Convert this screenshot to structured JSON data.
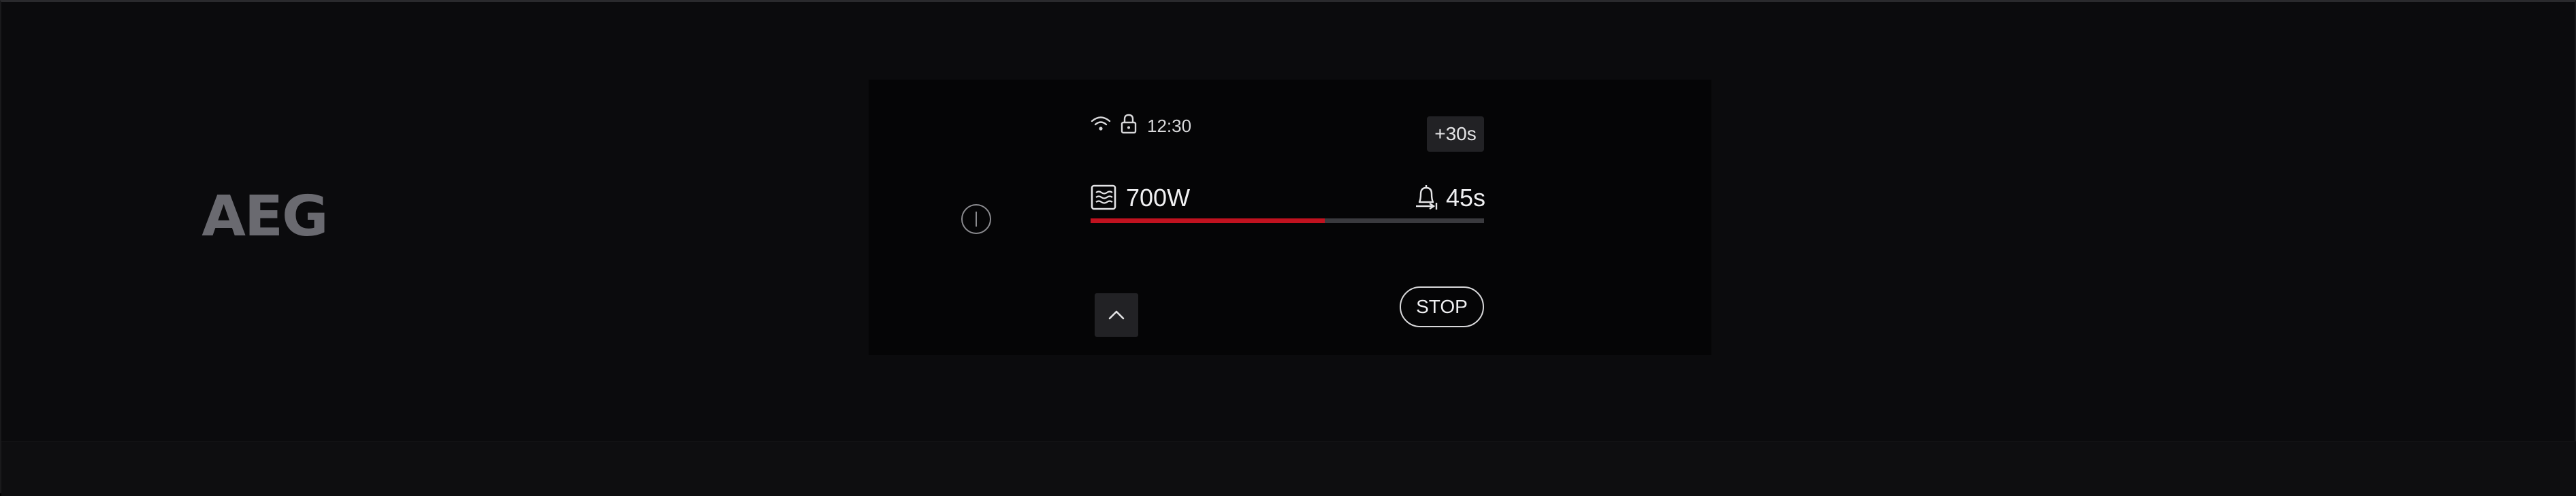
{
  "brand": {
    "logo_text": "AEG"
  },
  "status_bar": {
    "icons": [
      "wifi-icon",
      "lock-icon"
    ],
    "time": "12:30"
  },
  "controls": {
    "add_time_label": "+30s",
    "stop_label": "STOP",
    "power_icon": "power-icon",
    "up_icon": "chevron-up-icon"
  },
  "cooking": {
    "mode_icon": "microwave-icon",
    "power": "700W",
    "timer_icon": "bell-timer-icon",
    "remaining": "45s",
    "progress_fraction": 0.595
  },
  "colors": {
    "progress_fill": "#c1121f",
    "progress_track": "#3a3a3e",
    "logo": "#6a6a70"
  }
}
